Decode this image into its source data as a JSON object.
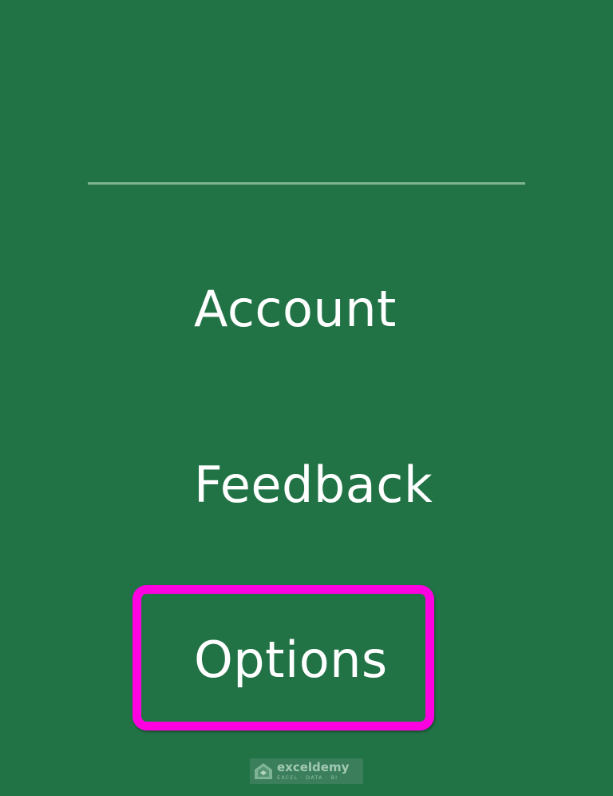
{
  "nav": {
    "items": [
      {
        "label": "Account"
      },
      {
        "label": "Feedback"
      },
      {
        "label": "Options"
      }
    ]
  },
  "highlight": {
    "color": "#ff00e1"
  },
  "theme": {
    "background": "#217346",
    "divider": "#7fb391",
    "text": "#ffffff"
  },
  "watermark": {
    "brand": "exceldemy",
    "tagline": "EXCEL · DATA · BI",
    "icon": "exceldemy-logo-icon"
  }
}
